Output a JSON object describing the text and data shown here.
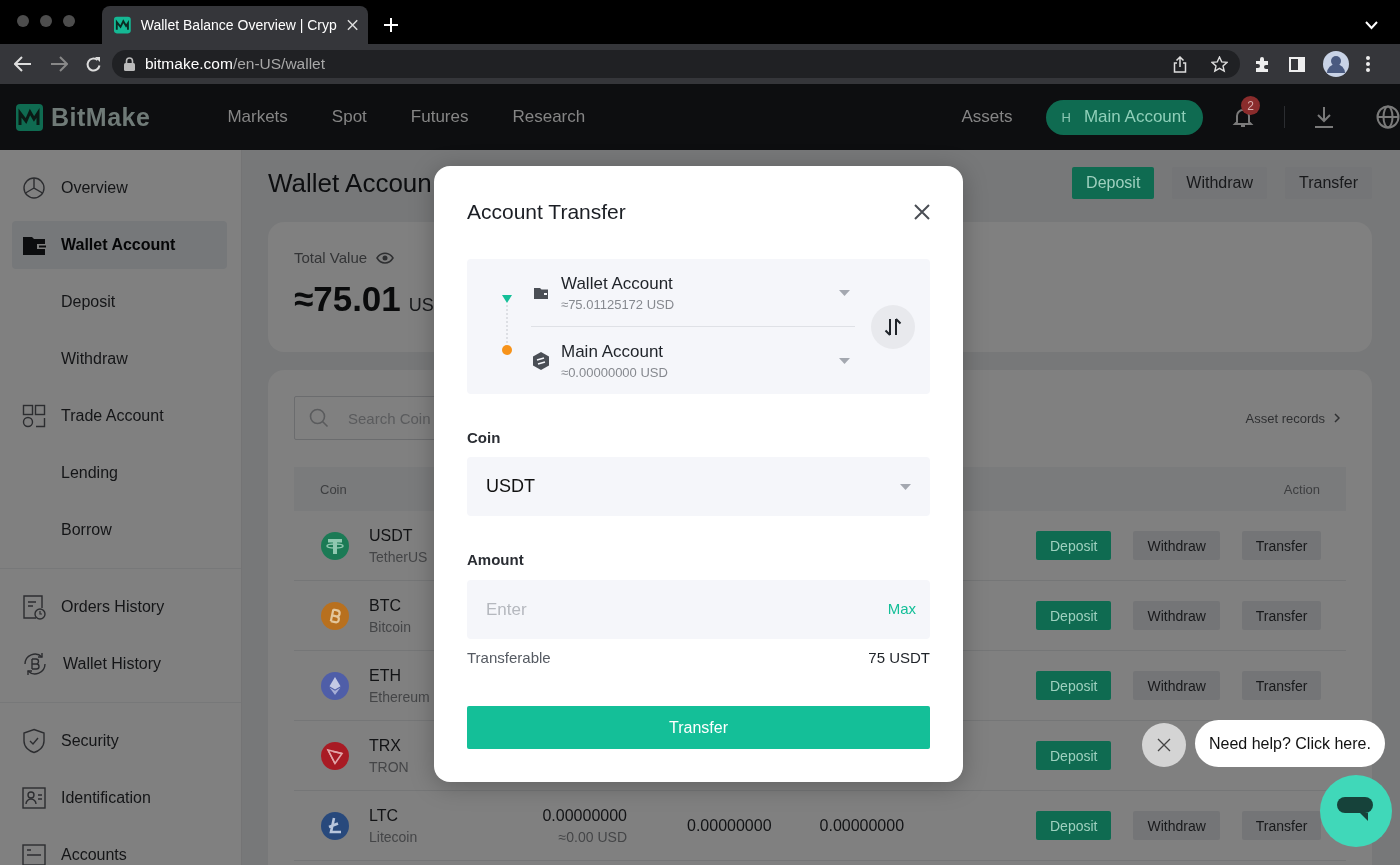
{
  "browser": {
    "tab_title": "Wallet Balance Overview | Cryp",
    "url_host": "bitmake.com",
    "url_path": "/en-US/wallet"
  },
  "header": {
    "logo": "BitMake",
    "nav": [
      {
        "label": "Markets"
      },
      {
        "label": "Spot"
      },
      {
        "label": "Futures"
      },
      {
        "label": "Research"
      }
    ],
    "assets": "Assets",
    "account": {
      "initial": "H",
      "label": "Main Account"
    },
    "notification_count": "2"
  },
  "sidebar": {
    "groups": [
      {
        "items": [
          {
            "label": "Overview",
            "selected": false
          },
          {
            "label": "Wallet Account",
            "selected": true,
            "children": [
              {
                "label": "Deposit",
                "selected": false
              },
              {
                "label": "Withdraw",
                "selected": false
              }
            ]
          },
          {
            "label": "Trade Account",
            "selected": false,
            "children": [
              {
                "label": "Lending",
                "selected": false
              },
              {
                "label": "Borrow",
                "selected": false
              }
            ]
          }
        ]
      },
      {
        "items": [
          {
            "label": "Orders History",
            "selected": false
          },
          {
            "label": "Wallet History",
            "selected": false
          }
        ]
      },
      {
        "items": [
          {
            "label": "Security",
            "selected": false
          },
          {
            "label": "Identification",
            "selected": false
          },
          {
            "label": "Accounts",
            "selected": false
          }
        ]
      }
    ]
  },
  "page": {
    "title": "Wallet Accoun",
    "actions": [
      {
        "label": "Deposit",
        "kind": "primary"
      },
      {
        "label": "Withdraw",
        "kind": "secondary"
      },
      {
        "label": "Transfer",
        "kind": "secondary"
      }
    ],
    "total": {
      "label": "Total Value",
      "value": "≈75.01",
      "unit": "US"
    },
    "search": {
      "placeholder": "Search Coin"
    },
    "asset_records": "Asset records",
    "table": {
      "columns": [
        {
          "label": "Coin"
        },
        {
          "label": "Action"
        }
      ],
      "rows": [
        {
          "symbol": "USDT",
          "name": "TetherUS",
          "actions": [
            {
              "label": "Deposit",
              "kind": "primary"
            },
            {
              "label": "Withdraw",
              "kind": "secondary"
            },
            {
              "label": "Transfer",
              "kind": "secondary"
            }
          ]
        },
        {
          "symbol": "BTC",
          "name": "Bitcoin",
          "actions": [
            {
              "label": "Deposit",
              "kind": "primary"
            },
            {
              "label": "Withdraw",
              "kind": "secondary"
            },
            {
              "label": "Transfer",
              "kind": "secondary"
            }
          ]
        },
        {
          "symbol": "ETH",
          "name": "Ethereum",
          "actions": [
            {
              "label": "Deposit",
              "kind": "primary"
            },
            {
              "label": "Withdraw",
              "kind": "secondary"
            },
            {
              "label": "Transfer",
              "kind": "secondary"
            }
          ]
        },
        {
          "symbol": "TRX",
          "name": "TRON",
          "actions": [
            {
              "label": "Deposit",
              "kind": "primary"
            }
          ]
        },
        {
          "symbol": "LTC",
          "name": "Litecoin",
          "balance": "0.00000000",
          "balance_usd": "≈0.00 USD",
          "column_3": "0.00000000",
          "column_4": "0.00000000",
          "actions": [
            {
              "label": "Deposit",
              "kind": "primary"
            },
            {
              "label": "Withdraw",
              "kind": "secondary"
            },
            {
              "label": "Transfer",
              "kind": "secondary"
            }
          ]
        }
      ]
    }
  },
  "modal": {
    "title": "Account Transfer",
    "from": {
      "name": "Wallet Account",
      "value": "≈75.01125172 USD"
    },
    "to": {
      "name": "Main Account",
      "value": "≈0.00000000 USD"
    },
    "coin": {
      "label": "Coin",
      "value": "USDT"
    },
    "amount": {
      "label": "Amount",
      "placeholder": "Enter",
      "max": "Max"
    },
    "transferable": {
      "label": "Transferable",
      "value": "75 USDT"
    },
    "submit": "Transfer"
  },
  "help": {
    "message": "Need help? Click here."
  }
}
